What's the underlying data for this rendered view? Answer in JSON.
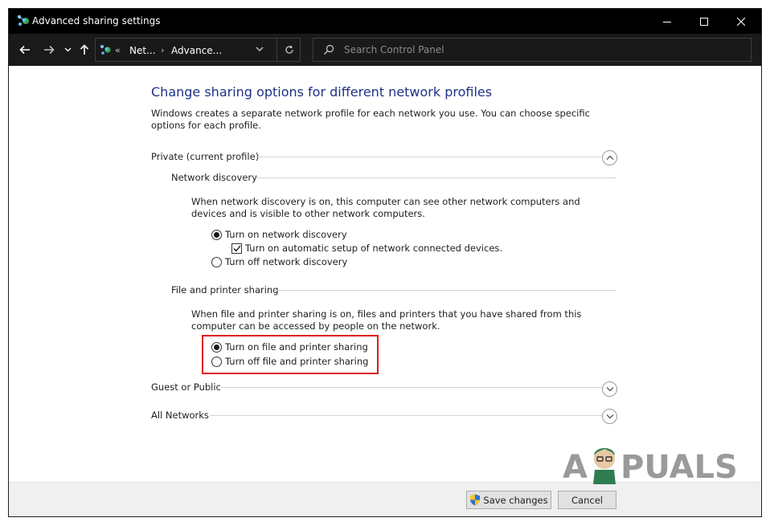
{
  "window": {
    "title": "Advanced sharing settings"
  },
  "nav": {
    "breadcrumb_separator": "«",
    "breadcrumb_1": "Net...",
    "breadcrumb_arrow": "›",
    "breadcrumb_2": "Advance...",
    "search_placeholder": "Search Control Panel"
  },
  "main": {
    "heading": "Change sharing options for different network profiles",
    "intro": "Windows creates a separate network profile for each network you use. You can choose specific options for each profile.",
    "private_profile": {
      "label": "Private (current profile)",
      "expanded": true,
      "network_discovery": {
        "label": "Network discovery",
        "description": "When network discovery is on, this computer can see other network computers and devices and is visible to other network computers.",
        "turn_on_label": "Turn on network discovery",
        "turn_on_selected": true,
        "auto_setup_label": "Turn on automatic setup of network connected devices.",
        "auto_setup_checked": true,
        "turn_off_label": "Turn off network discovery",
        "turn_off_selected": false
      },
      "file_printer_sharing": {
        "label": "File and printer sharing",
        "description": "When file and printer sharing is on, files and printers that you have shared from this computer can be accessed by people on the network.",
        "turn_on_label": "Turn on file and printer sharing",
        "turn_on_selected": true,
        "turn_off_label": "Turn off file and printer sharing",
        "turn_off_selected": false
      }
    },
    "guest_public": {
      "label": "Guest or Public",
      "expanded": false
    },
    "all_networks": {
      "label": "All Networks",
      "expanded": false
    }
  },
  "footer": {
    "save_label": "Save changes",
    "cancel_label": "Cancel"
  },
  "watermark": {
    "text_a": "A",
    "text_puals": "PUALS"
  },
  "colors": {
    "heading": "#1e3287",
    "highlight_box": "#e0191e",
    "titlebar": "#000000",
    "navbar": "#1a1a1a"
  }
}
